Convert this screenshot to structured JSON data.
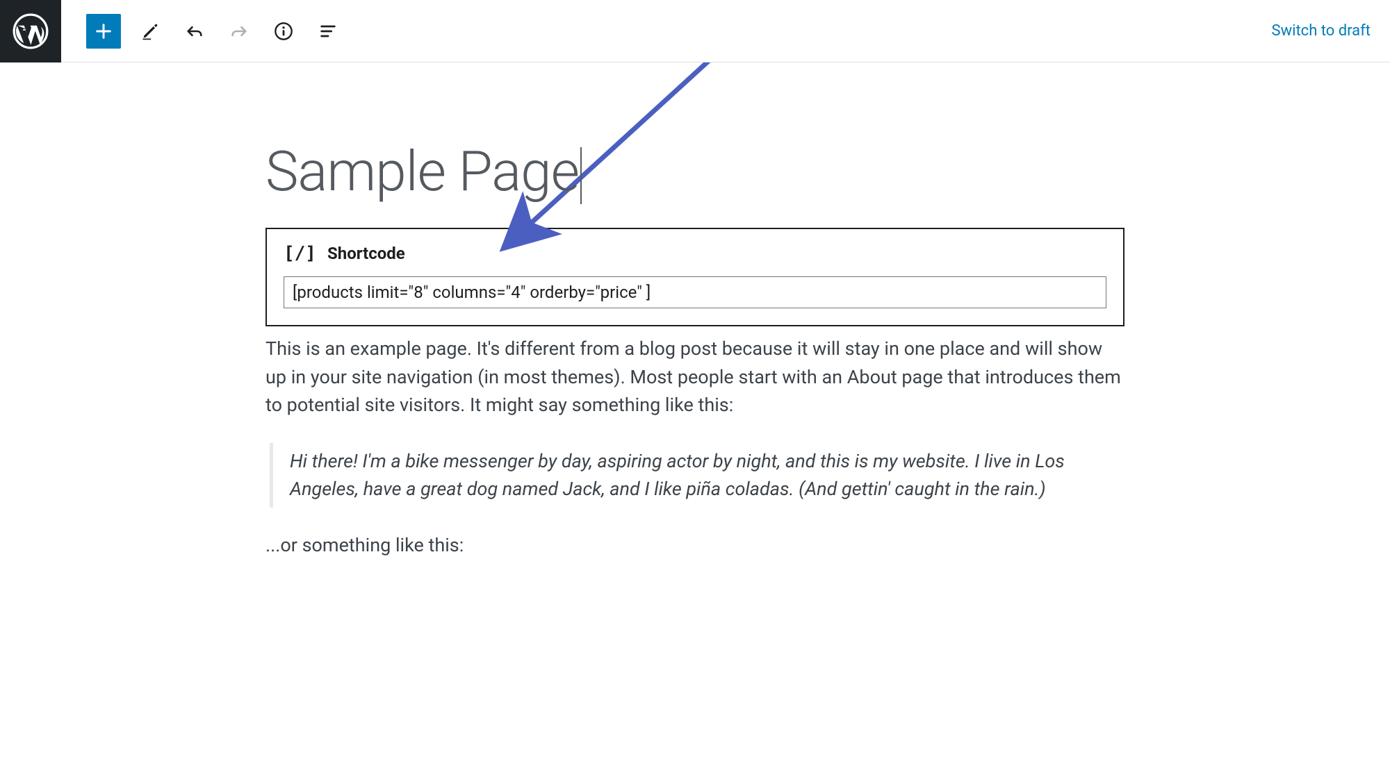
{
  "toolbar": {
    "add_block_label": "Add block",
    "switch_draft": "Switch to draft"
  },
  "page": {
    "title": "Sample Page"
  },
  "shortcode": {
    "label": "Shortcode",
    "value": "[products limit=\"8\" columns=\"4\" orderby=\"price\" ]",
    "misspelled_word": "orderby"
  },
  "content": {
    "paragraph1": "This is an example page. It's different from a blog post because it will stay in one place and will show up in your site navigation (in most themes). Most people start with an About page that introduces them to potential site visitors. It might say something like this:",
    "quote": "Hi there! I'm a bike messenger by day, aspiring actor by night, and this is my website. I live in Los Angeles, have a great dog named Jack, and I like piña coladas. (And gettin' caught in the rain.)",
    "paragraph2": "...or something like this:"
  },
  "icons": {
    "shortcode_glyph": "[/]"
  },
  "colors": {
    "accent": "#007cba",
    "arrow": "#4b5fc1"
  }
}
